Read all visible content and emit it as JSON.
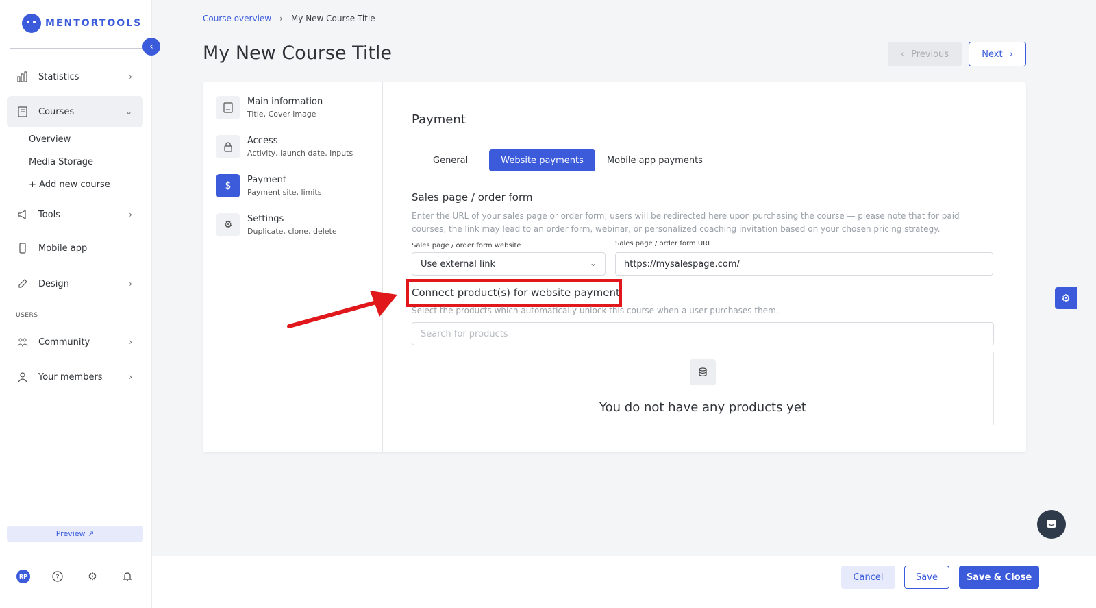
{
  "brand": {
    "name": "MENTORTOOLS",
    "accent": "#3b5bdb"
  },
  "sidebar": {
    "items": [
      {
        "label": "Statistics",
        "icon": "bar-chart-icon"
      },
      {
        "label": "Courses",
        "icon": "book-icon"
      },
      {
        "label": "Tools",
        "icon": "megaphone-icon"
      },
      {
        "label": "Mobile app",
        "icon": "phone-icon"
      },
      {
        "label": "Design",
        "icon": "pencil-icon"
      },
      {
        "label": "Community",
        "icon": "people-icon"
      },
      {
        "label": "Your members",
        "icon": "user-icon"
      }
    ],
    "course_subitems": [
      "Overview",
      "Media Storage",
      "+ Add new course"
    ],
    "section_users": "USERS",
    "preview_label": "Preview ↗",
    "avatar_initials": "RP"
  },
  "breadcrumb": {
    "link": "Course overview",
    "current": "My New Course Title"
  },
  "page_title": "My New Course Title",
  "pager": {
    "previous": "Previous",
    "next": "Next"
  },
  "steps": [
    {
      "title": "Main information",
      "subtitle": "Title, Cover image",
      "icon": "document-icon"
    },
    {
      "title": "Access",
      "subtitle": "Activity, launch date, inputs",
      "icon": "lock-icon"
    },
    {
      "title": "Payment",
      "subtitle": "Payment site, limits",
      "icon": "dollar-icon"
    },
    {
      "title": "Settings",
      "subtitle": "Duplicate, clone, delete",
      "icon": "gear-icon"
    }
  ],
  "payment": {
    "title": "Payment",
    "tabs": [
      "General",
      "Website payments",
      "Mobile app payments"
    ],
    "active_tab": "Website payments",
    "sales_heading": "Sales page / order form",
    "sales_helper": "Enter the URL of your sales page or order form; users will be redirected here upon purchasing the course — please note that for paid courses, the link may lead to an order form, webinar, or personalized coaching invitation based on your chosen pricing strategy.",
    "website_label": "Sales page / order form website",
    "website_value": "Use external link",
    "url_label": "Sales page / order form URL",
    "url_value": "https://mysalespage.com/",
    "connect_title": "Connect product(s) for website payment",
    "connect_helper": "Select the products which automatically unlock this course when a user purchases them.",
    "search_placeholder": "Search for products",
    "empty_text": "You do not have any products yet"
  },
  "footer": {
    "cancel": "Cancel",
    "save": "Save",
    "save_close": "Save & Close"
  }
}
